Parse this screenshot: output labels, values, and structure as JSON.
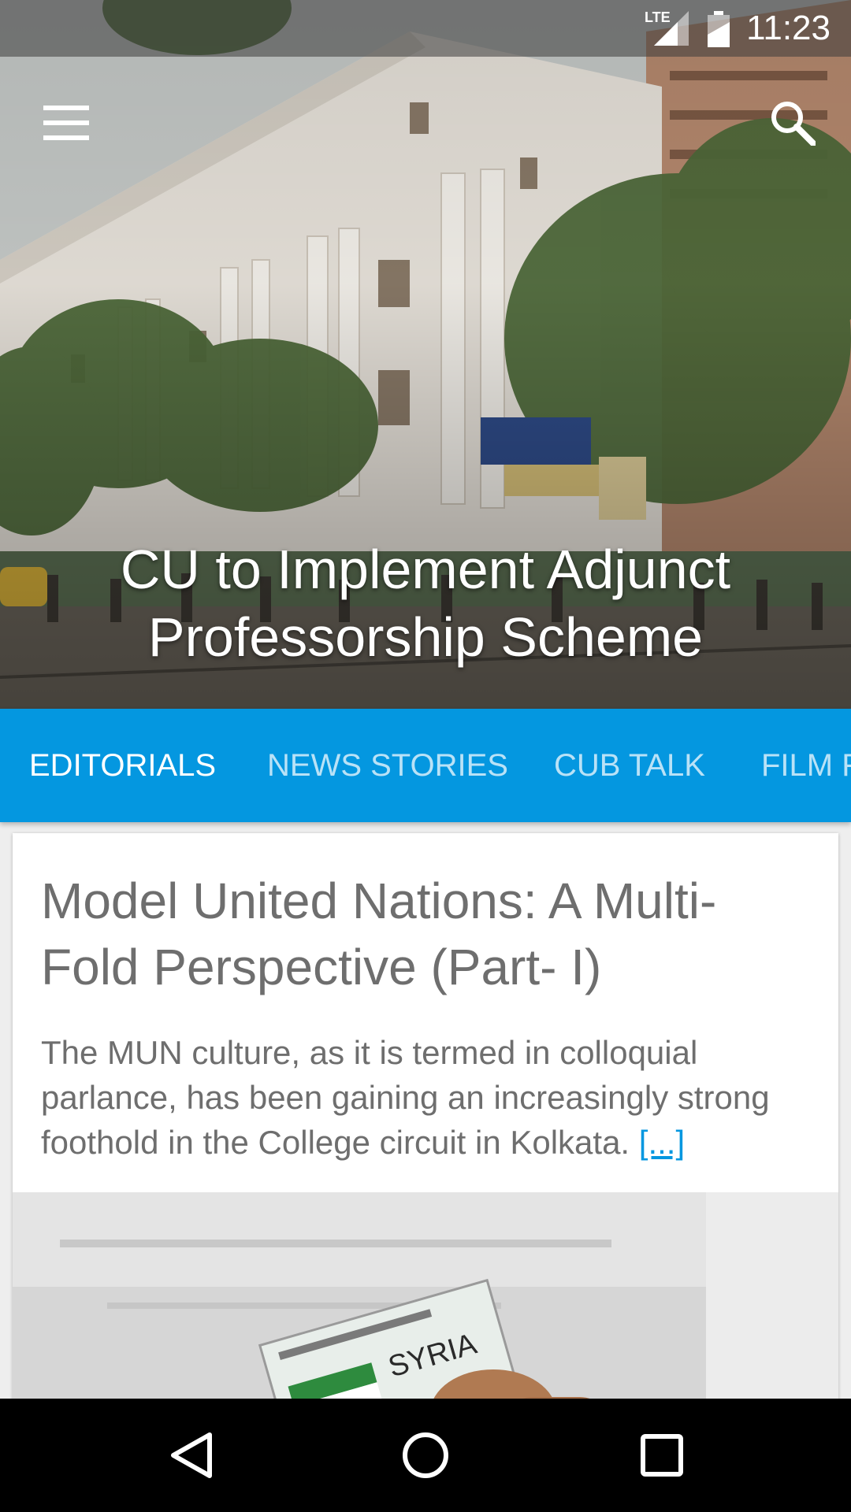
{
  "status_bar": {
    "time": "11:23",
    "network": "LTE",
    "icons": [
      "signal-icon",
      "battery-icon"
    ]
  },
  "toolbar": {
    "menu_icon": "menu-icon",
    "search_icon": "search-icon"
  },
  "hero": {
    "title": "CU to Implement Adjunct Professorship Scheme"
  },
  "tabs": [
    {
      "label": "EDITORIALS",
      "active": true
    },
    {
      "label": "NEWS STORIES",
      "active": false
    },
    {
      "label": "CUB TALK",
      "active": false
    },
    {
      "label": "FILM F",
      "active": false
    }
  ],
  "colors": {
    "accent": "#0497e0",
    "text_gray": "#6e6e6e"
  },
  "article": {
    "title": "Model United Nations: A Multi-Fold Perspective (Part- I)",
    "excerpt": "The MUN culture, as it is termed in colloquial parlance, has been gaining an increasingly strong foothold in the College circuit in Kolkata.",
    "read_more": "[...]",
    "image_placard_text": "SYRIA"
  },
  "nav_bar": {
    "icons": [
      "back-icon",
      "home-icon",
      "recents-icon"
    ]
  }
}
